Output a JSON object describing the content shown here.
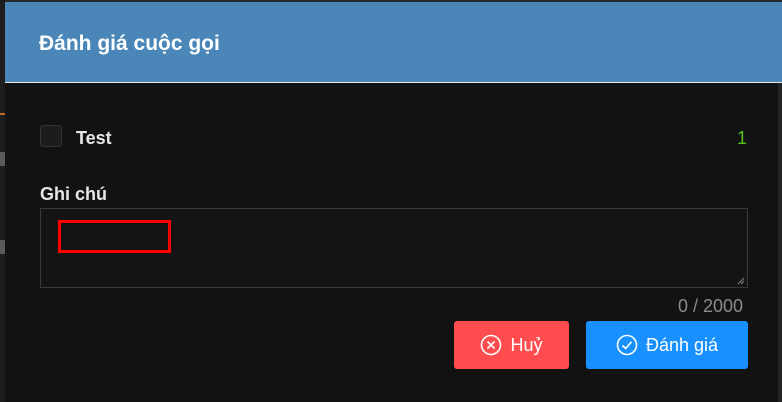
{
  "dialog": {
    "title": "Đánh giá cuộc gọi"
  },
  "criteria": [
    {
      "label": "Test",
      "count": "1",
      "checked": false
    }
  ],
  "note": {
    "label": "Ghi chú",
    "value": "",
    "counter": "0 / 2000"
  },
  "actions": {
    "cancel_label": "Huỷ",
    "cancel_icon": "close-circle-icon",
    "submit_label": "Đánh giá",
    "submit_icon": "check-circle-icon"
  },
  "colors": {
    "header": "#4a87b8",
    "body": "#121212",
    "cancel": "#ff4d4f",
    "submit": "#1890ff",
    "count": "#52c41a"
  }
}
